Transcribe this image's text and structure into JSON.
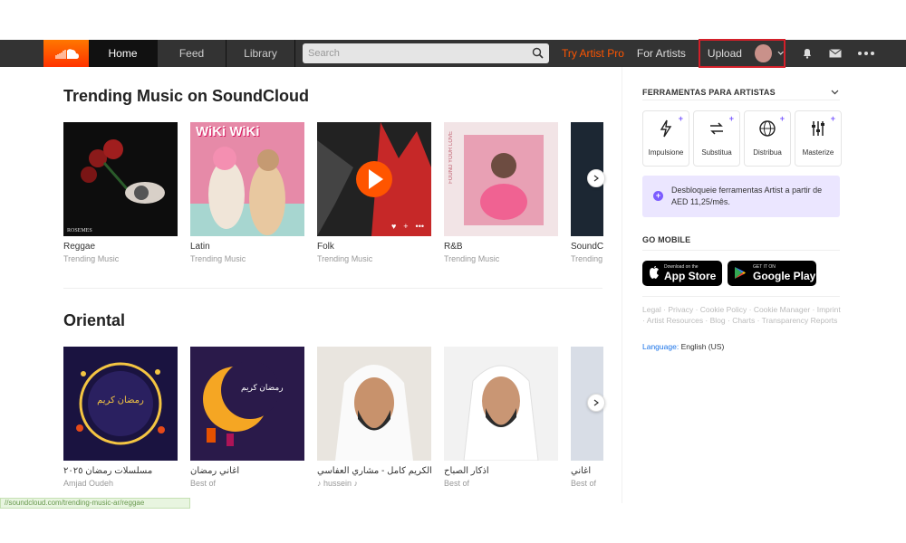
{
  "nav": {
    "tabs": [
      {
        "label": "Home",
        "active": true
      },
      {
        "label": "Feed",
        "active": false
      },
      {
        "label": "Library",
        "active": false
      }
    ],
    "search_placeholder": "Search",
    "try_pro": "Try Artist Pro",
    "for_artists": "For Artists",
    "upload": "Upload",
    "accent": "#ff5500"
  },
  "sections": [
    {
      "title": "Trending Music on SoundCloud",
      "cards": [
        {
          "title": "Reggae",
          "sub": "Trending Music",
          "overlay": "ROSEMES"
        },
        {
          "title": "Latin",
          "sub": "Trending Music",
          "overlay": "WiKi WiKi"
        },
        {
          "title": "Folk",
          "sub": "Trending Music",
          "overlay": ""
        },
        {
          "title": "R&B",
          "sub": "Trending Music",
          "overlay": "FOUND YOUR LOVE"
        },
        {
          "title": "SoundC",
          "sub": "Trending",
          "overlay": ""
        }
      ]
    },
    {
      "title": "Oriental",
      "cards": [
        {
          "title": "مسلسلات رمضان ٢٠٢٥",
          "sub": "Amjad Oudeh",
          "overlay": "رمضان كريم"
        },
        {
          "title": "اغاني رمضان",
          "sub": "Best of",
          "overlay": "رمضان كريم"
        },
        {
          "title": "الكريم كامل - مشاري العفاسي",
          "sub": "♪ hussein ♪",
          "overlay": ""
        },
        {
          "title": "اذكار الصباح",
          "sub": "Best of",
          "overlay": ""
        },
        {
          "title": "اغاني",
          "sub": "Best of",
          "overlay": ""
        }
      ]
    }
  ],
  "sidebar": {
    "tools_title": "FERRAMENTAS PARA ARTISTAS",
    "tools": [
      {
        "label": "Impulsione",
        "icon": "boost-icon"
      },
      {
        "label": "Substitua",
        "icon": "replace-icon"
      },
      {
        "label": "Distribua",
        "icon": "distribute-icon"
      },
      {
        "label": "Masterize",
        "icon": "mastering-icon"
      }
    ],
    "unlock_text": "Desbloqueie ferramentas Artist a partir de AED 11,25/mês.",
    "go_mobile": "GO MOBILE",
    "app_store_small": "Download on the",
    "app_store_big": "App Store",
    "google_small": "GET IT ON",
    "google_big": "Google Play",
    "footer_links": "Legal · Privacy · Cookie Policy · Cookie Manager · Imprint · Artist Resources · Blog · Charts · Transparency Reports",
    "language_label": "Language:",
    "language_value": "English (US)"
  },
  "status_url": "//soundcloud.com/trending-music-ar/reggae"
}
